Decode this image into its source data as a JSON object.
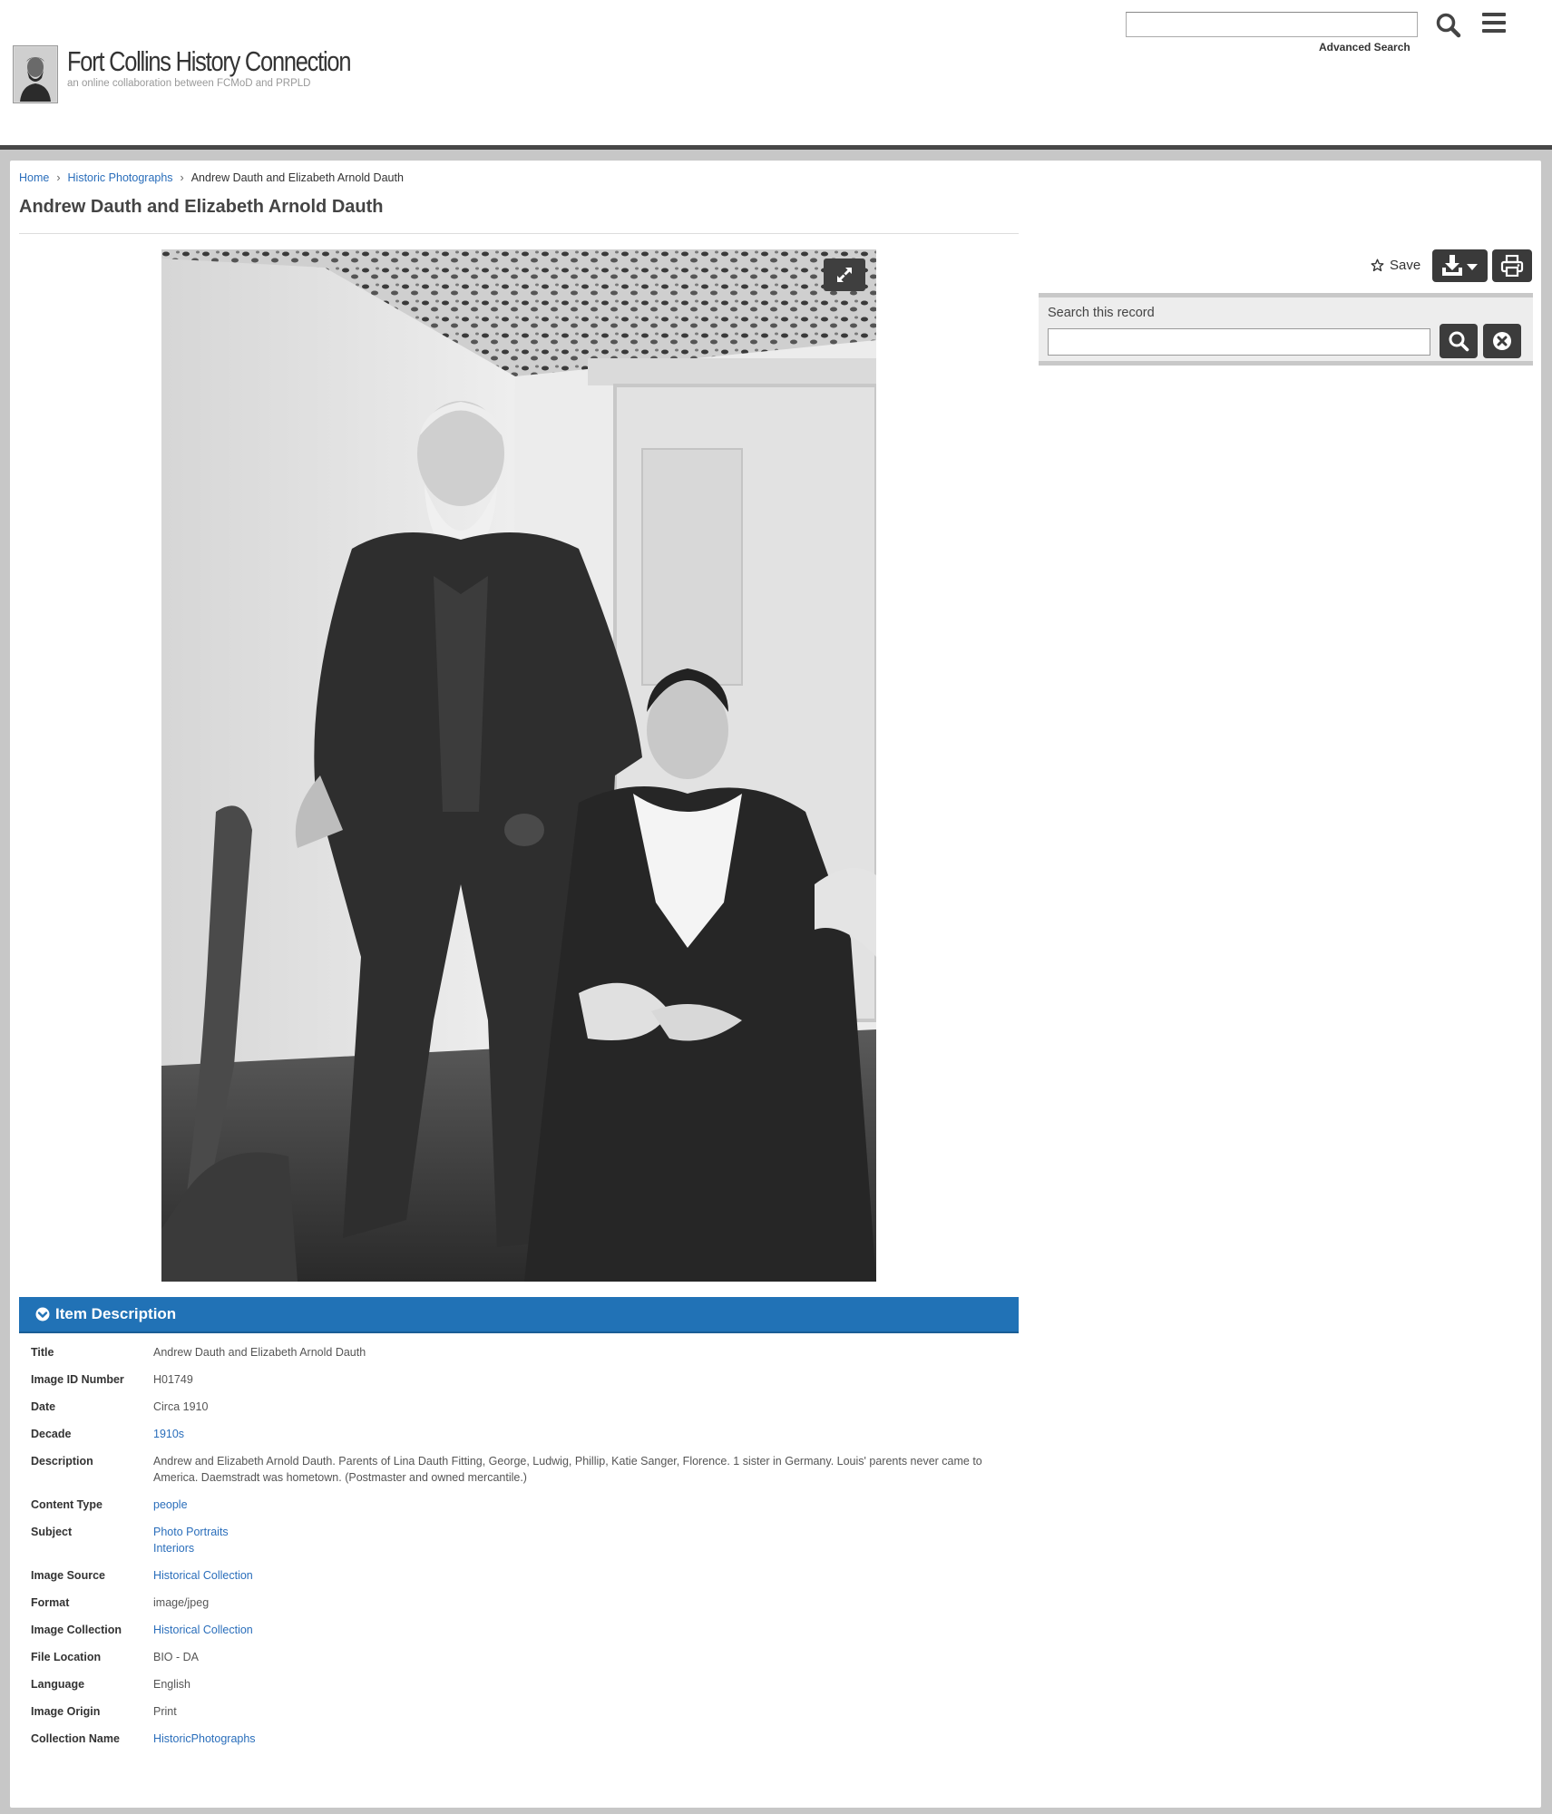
{
  "header": {
    "logo_title": "Fort Collins History Connection",
    "logo_subtitle": "an online collaboration between FCMoD and PRPLD",
    "advanced_search": "Advanced Search",
    "search_icon": "search-icon",
    "menu_icon": "hamburger-menu-icon"
  },
  "breadcrumb": {
    "home": "Home",
    "collection": "Historic Photographs",
    "current": "Andrew Dauth and Elizabeth Arnold Dauth"
  },
  "page_title": "Andrew Dauth and Elizabeth Arnold Dauth",
  "toolbar": {
    "save_label": "Save",
    "save_icon": "star-outline-icon",
    "download_icon": "download-icon",
    "print_icon": "print-icon",
    "expand_icon": "expand-icon"
  },
  "record_search": {
    "label": "Search this record",
    "search_icon": "search-icon",
    "clear_icon": "clear-x-circle-icon"
  },
  "item_description": {
    "heading": "Item Description",
    "fields": {
      "title": {
        "label": "Title",
        "value": "Andrew Dauth and Elizabeth Arnold Dauth"
      },
      "image_id": {
        "label": "Image ID Number",
        "value": "H01749"
      },
      "date": {
        "label": "Date",
        "value": "Circa 1910"
      },
      "decade": {
        "label": "Decade",
        "value": "1910s"
      },
      "description": {
        "label": "Description",
        "value": "Andrew and Elizabeth Arnold Dauth. Parents of Lina Dauth Fitting, George, Ludwig, Phillip, Katie Sanger, Florence. 1 sister in Germany. Louis' parents never came to America. Daemstradt was hometown. (Postmaster and owned mercantile.)"
      },
      "content_type": {
        "label": "Content Type",
        "value": "people"
      },
      "subject": {
        "label": "Subject",
        "values": [
          "Photo Portraits",
          "Interiors"
        ]
      },
      "image_source": {
        "label": "Image Source",
        "value": "Historical Collection"
      },
      "format": {
        "label": "Format",
        "value": "image/jpeg"
      },
      "image_collection": {
        "label": "Image Collection",
        "value": "Historical Collection"
      },
      "file_location": {
        "label": "File Location",
        "value": "BIO - DA"
      },
      "language": {
        "label": "Language",
        "value": "English"
      },
      "image_origin": {
        "label": "Image Origin",
        "value": "Print"
      },
      "collection_name": {
        "label": "Collection Name",
        "value": "HistoricPhotographs"
      }
    }
  },
  "colors": {
    "accent_blue": "#2172b6",
    "link_blue": "#2a6ebb",
    "dark_button": "#3a3a3a",
    "frame_gray": "#c7c7c7"
  }
}
